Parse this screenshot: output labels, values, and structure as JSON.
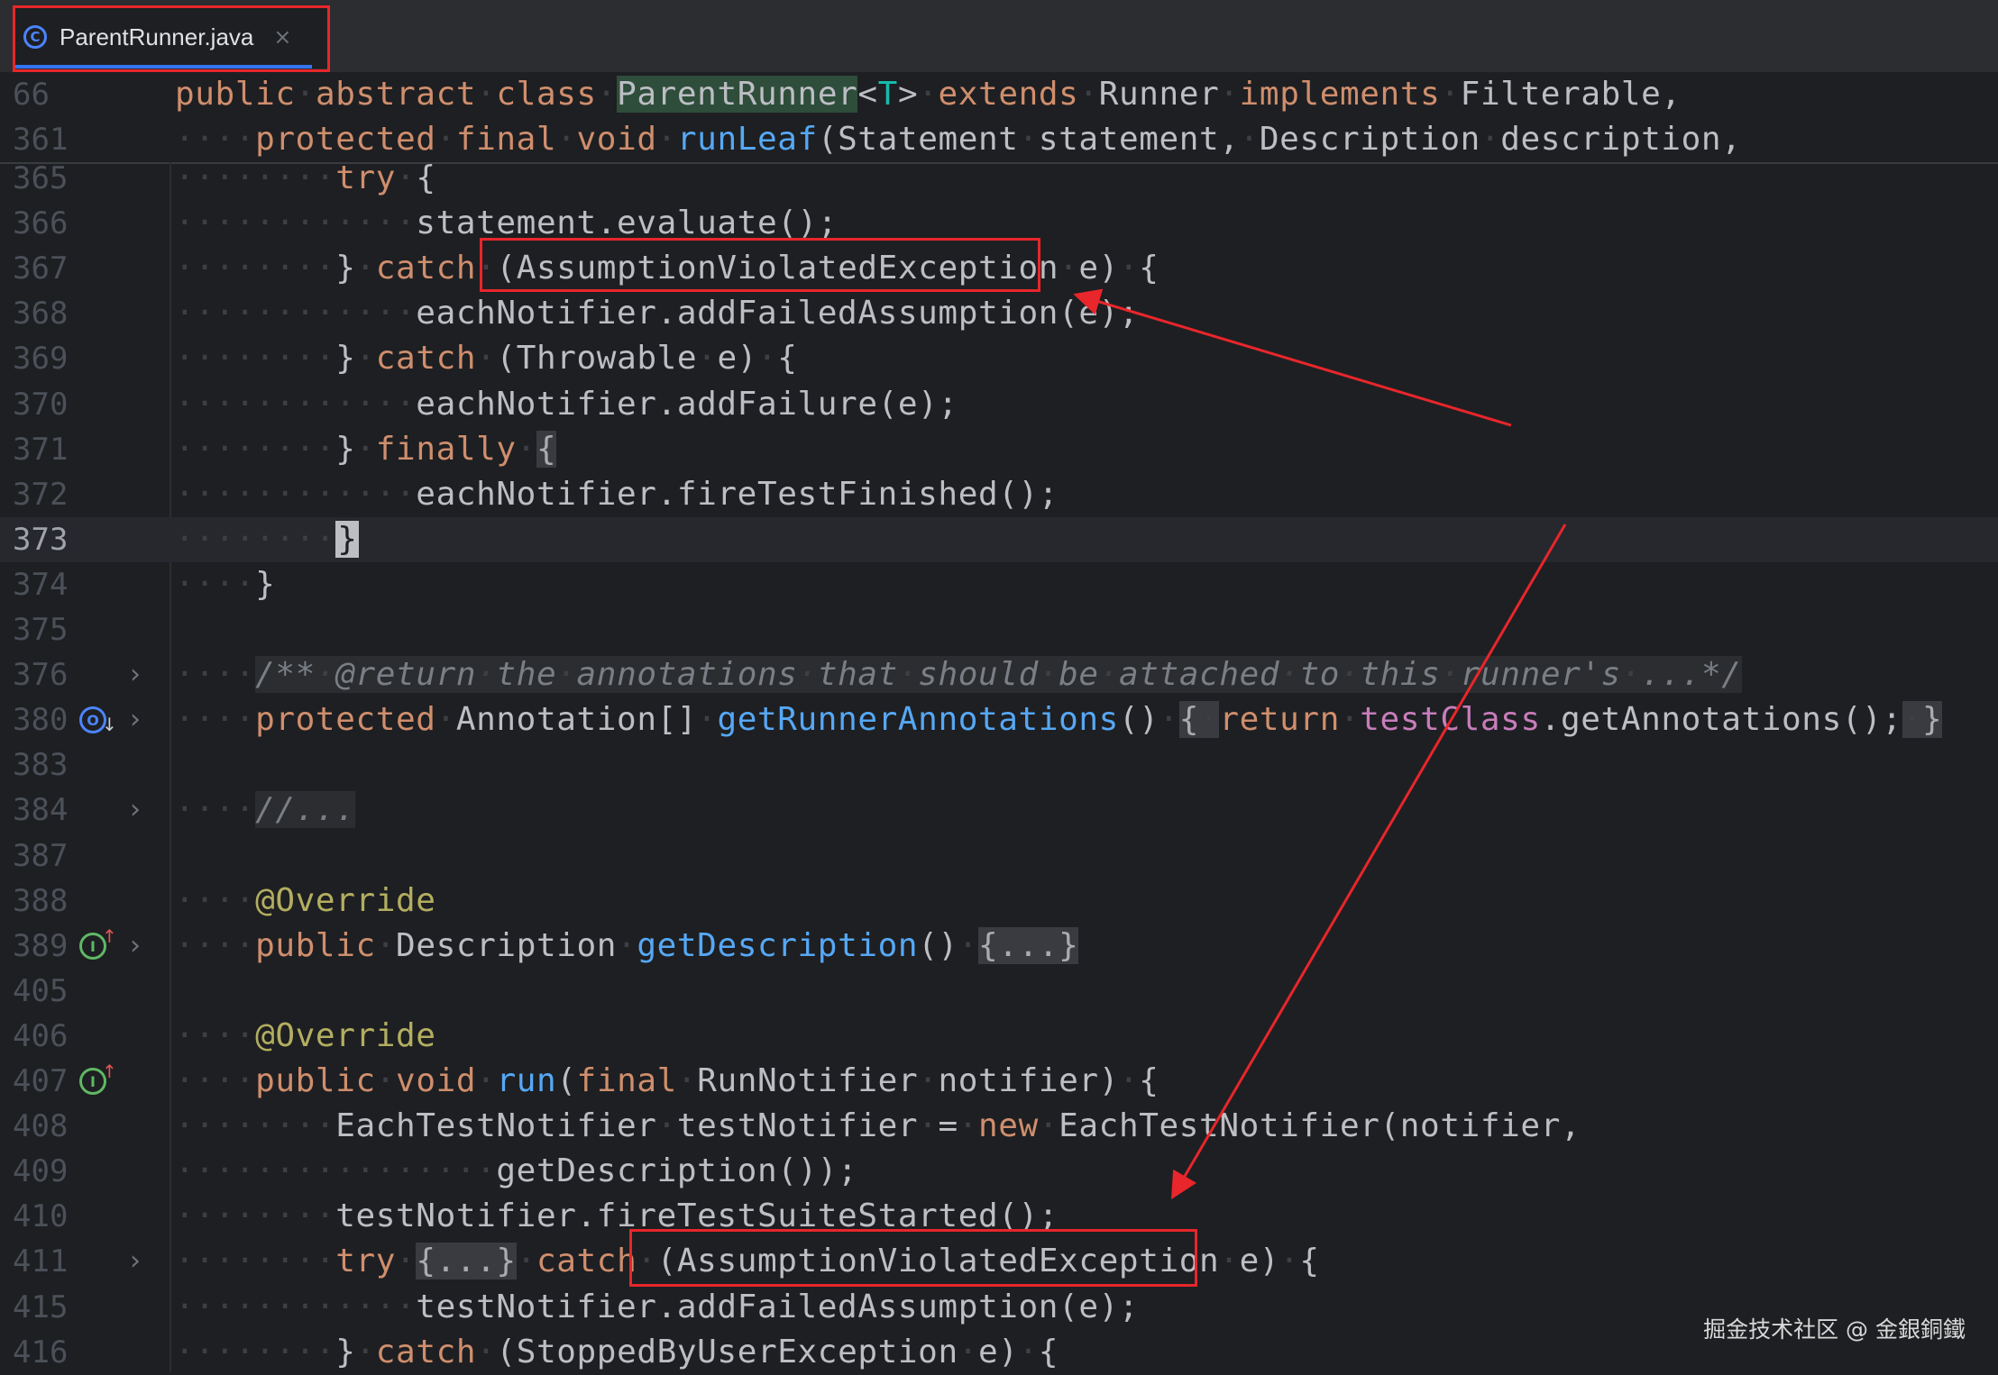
{
  "tab": {
    "title": "ParentRunner.java",
    "icon": "class-icon",
    "close_symbol": "×"
  },
  "sticky": [
    {
      "ln": "66",
      "html": "<span class=\"kw\">public</span><span class=\"dot\">·</span><span class=\"kw\">abstract</span><span class=\"dot\">·</span><span class=\"kw\">class</span><span class=\"dot\">·</span><span class=\"hlname\">ParentRunner</span>&lt;<span class=\"tp\">T</span>&gt;<span class=\"dot\">·</span><span class=\"kw\">extends</span><span class=\"dot\">·</span>Runner<span class=\"dot\">·</span><span class=\"kw\">implements</span><span class=\"dot\">·</span>Filterable,"
    },
    {
      "ln": "361",
      "html": "<span class=\"dot\">····</span><span class=\"kw\">protected</span><span class=\"dot\">·</span><span class=\"kw\">final</span><span class=\"dot\">·</span><span class=\"kw\">void</span><span class=\"dot\">·</span><span class=\"fn\">runLeaf</span>(Statement<span class=\"dot\">·</span>statement,<span class=\"dot\">·</span>Description<span class=\"dot\">·</span>description,"
    }
  ],
  "lines": [
    {
      "ln": "365",
      "html": "<span class=\"dot\">········</span><span class=\"kw\">try</span><span class=\"dot\">·</span>{"
    },
    {
      "ln": "366",
      "html": "<span class=\"dot\">············</span>statement.evaluate();"
    },
    {
      "ln": "367",
      "html": "<span class=\"dot\">········</span>}<span class=\"dot\">·</span><span class=\"kw\">catch</span><span class=\"dot\">·</span>(AssumptionViolatedException<span class=\"dot\">·</span>e)<span class=\"dot\">·</span>{"
    },
    {
      "ln": "368",
      "html": "<span class=\"dot\">············</span>eachNotifier.addFailedAssumption(e);"
    },
    {
      "ln": "369",
      "html": "<span class=\"dot\">········</span>}<span class=\"dot\">·</span><span class=\"kw\">catch</span><span class=\"dot\">·</span>(Throwable<span class=\"dot\">·</span>e)<span class=\"dot\">·</span>{"
    },
    {
      "ln": "370",
      "html": "<span class=\"dot\">············</span>eachNotifier.addFailure(e);"
    },
    {
      "ln": "371",
      "html": "<span class=\"dot\">········</span>}<span class=\"dot\">·</span><span class=\"kw\">finally</span><span class=\"dot\">·</span><span class=\"fold-bg\">{</span>"
    },
    {
      "ln": "372",
      "html": "<span class=\"dot\">············</span>eachNotifier.fireTestFinished();"
    },
    {
      "ln": "373",
      "current": true,
      "html": "<span class=\"dot\">········</span><span class=\"caret-box\">}</span>"
    },
    {
      "ln": "374",
      "html": "<span class=\"dot\">····</span>}"
    },
    {
      "ln": "375",
      "html": ""
    },
    {
      "ln": "376",
      "fold": true,
      "html": "<span class=\"dot\">····</span><span class=\"cm cm-bg\">/**<span class=\"dot\">·</span>@return<span class=\"dot\">·</span>the<span class=\"dot\">·</span>annotations<span class=\"dot\">·</span>that<span class=\"dot\">·</span>should<span class=\"dot\">·</span>be<span class=\"dot\">·</span>attached<span class=\"dot\">·</span>to<span class=\"dot\">·</span>this<span class=\"dot\">·</span>runner's<span class=\"dot\">·</span>...*/</span>"
    },
    {
      "ln": "380",
      "fold": true,
      "icon": "ovr",
      "html": "<span class=\"dot\">····</span><span class=\"kw\">protected</span><span class=\"dot\">·</span>Annotation[]<span class=\"dot\">·</span><span class=\"fn\">getRunnerAnnotations</span>()<span class=\"dot\">·</span><span class=\"fold-bg\">{<span class=\"dot\">·</span></span><span class=\"kw\">return</span><span class=\"dot\">·</span><span class=\"fld\">testClass</span>.getAnnotations();<span class=\"fold-bg\"><span class=\"dot\">·</span>}</span>"
    },
    {
      "ln": "383",
      "html": ""
    },
    {
      "ln": "384",
      "fold": true,
      "html": "<span class=\"dot\">····</span><span class=\"cm cm-bg\">//...</span>"
    },
    {
      "ln": "387",
      "html": ""
    },
    {
      "ln": "388",
      "html": "<span class=\"dot\">····</span><span class=\"ann\">@Override</span>"
    },
    {
      "ln": "389",
      "fold": true,
      "icon": "impl",
      "html": "<span class=\"dot\">····</span><span class=\"kw\">public</span><span class=\"dot\">·</span>Description<span class=\"dot\">·</span><span class=\"fn\">getDescription</span>()<span class=\"dot\">·</span><span class=\"fold-bg\">{...}</span>"
    },
    {
      "ln": "405",
      "html": ""
    },
    {
      "ln": "406",
      "html": "<span class=\"dot\">····</span><span class=\"ann\">@Override</span>"
    },
    {
      "ln": "407",
      "icon": "impl",
      "html": "<span class=\"dot\">····</span><span class=\"kw\">public</span><span class=\"dot\">·</span><span class=\"kw\">void</span><span class=\"dot\">·</span><span class=\"fn\">run</span>(<span class=\"kw\">final</span><span class=\"dot\">·</span>RunNotifier<span class=\"dot\">·</span>notifier)<span class=\"dot\">·</span>{"
    },
    {
      "ln": "408",
      "html": "<span class=\"dot\">········</span>EachTestNotifier<span class=\"dot\">·</span>testNotifier<span class=\"dot\">·</span>=<span class=\"dot\">·</span><span class=\"kw\">new</span><span class=\"dot\">·</span>EachTestNotifier(notifier,"
    },
    {
      "ln": "409",
      "html": "<span class=\"dot\">················</span>getDescription());"
    },
    {
      "ln": "410",
      "html": "<span class=\"dot\">········</span>testNotifier.fireTestSuiteStarted();"
    },
    {
      "ln": "411",
      "fold": true,
      "html": "<span class=\"dot\">········</span><span class=\"kw\">try</span><span class=\"dot\">·</span><span class=\"fold-bg\">{...}</span><span class=\"dot\">·</span><span class=\"kw\">catch</span><span class=\"dot\">·</span>(AssumptionViolatedException<span class=\"dot\">·</span>e)<span class=\"dot\">·</span>{"
    },
    {
      "ln": "415",
      "html": "<span class=\"dot\">············</span>testNotifier.addFailedAssumption(e);"
    },
    {
      "ln": "416",
      "html": "<span class=\"dot\">········</span>}<span class=\"dot\">·</span><span class=\"kw\">catch</span><span class=\"dot\">·</span>(StoppedByUserException<span class=\"dot\">·</span>e)<span class=\"dot\">·</span>{"
    }
  ],
  "colors": {
    "annotation_red": "#e8262b",
    "background": "#1e1f22",
    "keyword": "#cf8e6d",
    "method": "#56a8f5"
  },
  "watermark": "掘金技术社区 @ 金銀銅鐵"
}
